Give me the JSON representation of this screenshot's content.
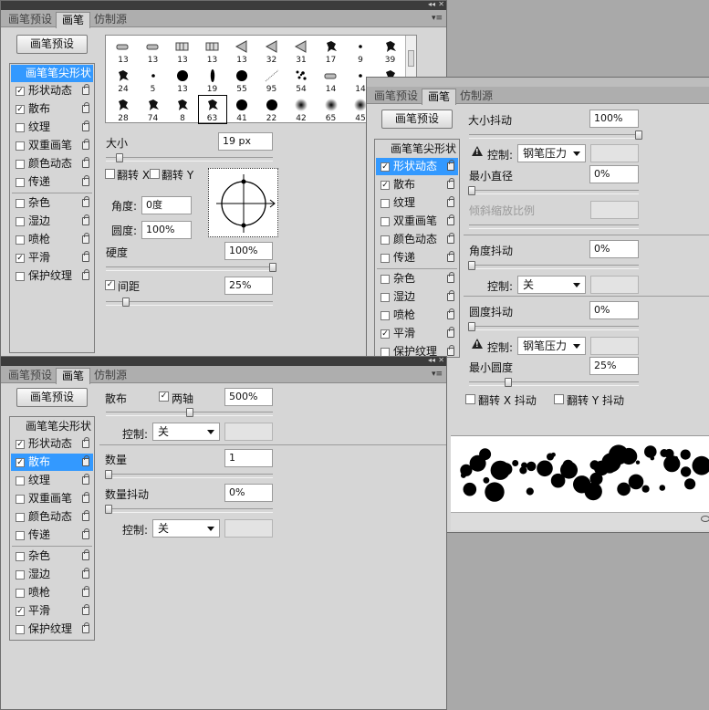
{
  "panels": {
    "tabs": [
      "画笔预设",
      "画笔",
      "仿制源"
    ],
    "preset_button": "画笔预设",
    "sidebar_head": "画笔笔尖形状",
    "sidebar_items": [
      {
        "label": "形状动态",
        "checked": true
      },
      {
        "label": "散布",
        "checked": true
      },
      {
        "label": "纹理",
        "checked": false
      },
      {
        "label": "双重画笔",
        "checked": false
      },
      {
        "label": "颜色动态",
        "checked": false
      },
      {
        "label": "传递",
        "checked": false
      },
      {
        "label": "杂色",
        "checked": false
      },
      {
        "label": "湿边",
        "checked": false
      },
      {
        "label": "喷枪",
        "checked": false
      },
      {
        "label": "平滑",
        "checked": true
      },
      {
        "label": "保护纹理",
        "checked": false
      }
    ],
    "titlebar_collapse": "◂◂",
    "titlebar_close": "✕",
    "menu_icon": "▾≡"
  },
  "tip_panel": {
    "brush_tips": [
      {
        "num": "13",
        "shape": "pen"
      },
      {
        "num": "13",
        "shape": "pen"
      },
      {
        "num": "13",
        "shape": "flat"
      },
      {
        "num": "13",
        "shape": "flat"
      },
      {
        "num": "13",
        "shape": "fan"
      },
      {
        "num": "32",
        "shape": "fan"
      },
      {
        "num": "31",
        "shape": "fan"
      },
      {
        "num": "17",
        "shape": "splat"
      },
      {
        "num": "9",
        "shape": "dot"
      },
      {
        "num": "39",
        "shape": "splat"
      },
      {
        "num": "24",
        "shape": "splat"
      },
      {
        "num": "5",
        "shape": "dot"
      },
      {
        "num": "13",
        "shape": "round"
      },
      {
        "num": "19",
        "shape": "ellipse"
      },
      {
        "num": "55",
        "shape": "round"
      },
      {
        "num": "95",
        "shape": "line"
      },
      {
        "num": "54",
        "shape": "scatter"
      },
      {
        "num": "14",
        "shape": "pen"
      },
      {
        "num": "14",
        "shape": "dot"
      },
      {
        "num": "",
        "shape": "splat"
      },
      {
        "num": "28",
        "shape": "splat"
      },
      {
        "num": "74",
        "shape": "splat"
      },
      {
        "num": "8",
        "shape": "splat"
      },
      {
        "num": "63",
        "shape": "splat"
      },
      {
        "num": "41",
        "shape": "round"
      },
      {
        "num": "22",
        "shape": "round"
      },
      {
        "num": "42",
        "shape": "soft"
      },
      {
        "num": "65",
        "shape": "soft"
      },
      {
        "num": "45",
        "shape": "soft"
      }
    ],
    "size_label": "大小",
    "size_value": "19 px",
    "size_level": 0.08,
    "flipx_label": "翻转 X",
    "flipy_label": "翻转 Y",
    "angle_label": "角度:",
    "angle_value": "0度",
    "roundness_label": "圆度:",
    "roundness_value": "100%",
    "hardness_label": "硬度",
    "hardness_value": "100%",
    "hardness_level": 1.0,
    "spacing_label": "间距",
    "spacing_checked": true,
    "spacing_value": "25%",
    "spacing_level": 0.12
  },
  "shape_panel": {
    "size_jitter_label": "大小抖动",
    "size_jitter_value": "100%",
    "size_jitter_level": 1.0,
    "control_label": "控制:",
    "control1_value": "钢笔压力",
    "min_diameter_label": "最小直径",
    "min_diameter_value": "0%",
    "min_diameter_level": 0.0,
    "tilt_scale_label": "倾斜缩放比例",
    "angle_jitter_label": "角度抖动",
    "angle_jitter_value": "0%",
    "angle_jitter_level": 0.0,
    "control2_value": "关",
    "roundness_jitter_label": "圆度抖动",
    "roundness_jitter_value": "0%",
    "roundness_jitter_level": 0.0,
    "control3_value": "钢笔压力",
    "min_roundness_label": "最小圆度",
    "min_roundness_value": "25%",
    "min_roundness_level": 0.23,
    "flipx_jitter_label": "翻转 X 抖动",
    "flipy_jitter_label": "翻转 Y 抖动"
  },
  "scatter_panel": {
    "scatter_label": "散布",
    "both_axes_label": "两轴",
    "both_axes_checked": true,
    "scatter_value": "500%",
    "scatter_level": 0.5,
    "control_label": "控制:",
    "control1_value": "关",
    "count_label": "数量",
    "count_value": "1",
    "count_level": 0.0,
    "count_jitter_label": "数量抖动",
    "count_jitter_value": "0%",
    "count_jitter_level": 0.0,
    "control2_value": "关"
  }
}
